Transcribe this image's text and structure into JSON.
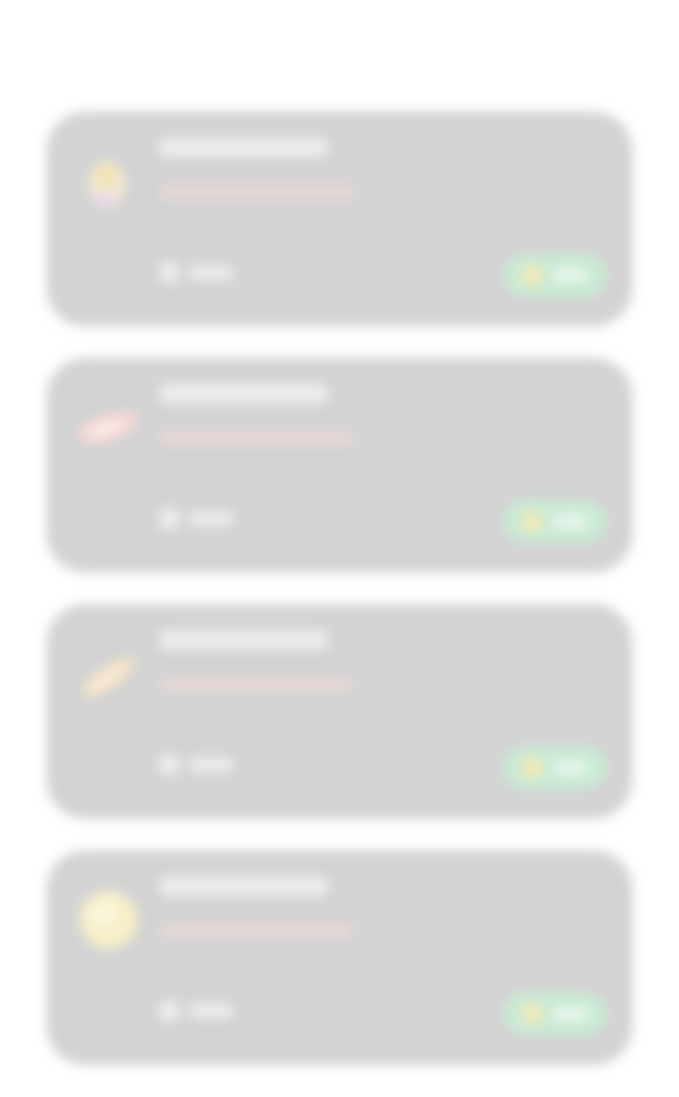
{
  "cards": [
    {
      "thumb": "cup-icon",
      "title": "",
      "subtitle": "",
      "meta": "",
      "badge": ""
    },
    {
      "thumb": "bread-icon",
      "title": "",
      "subtitle": "",
      "meta": "",
      "badge": ""
    },
    {
      "thumb": "baguette-icon",
      "title": "",
      "subtitle": "",
      "meta": "",
      "badge": ""
    },
    {
      "thumb": "cookie-icon",
      "title": "",
      "subtitle": "",
      "meta": "",
      "badge": ""
    }
  ],
  "colors": {
    "card_bg": "#d3d3d3",
    "badge_bg": "#c9ead4",
    "thumb_colors": [
      "#f3e1b4",
      "#f7d7d4",
      "#f4e1c6",
      "#f7efc8"
    ]
  }
}
